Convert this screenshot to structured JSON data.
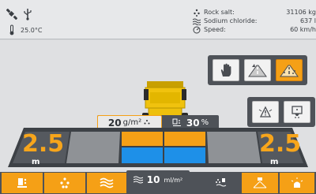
{
  "status": {
    "gps_icon": "satellite-gps-icon",
    "usb_icon": "usb-icon",
    "thermometer_icon": "thermometer-icon",
    "temperature": "25.0°C"
  },
  "stats": [
    {
      "icon": "salt-dots-icon",
      "label": "Rock salt:",
      "value": "31106 kg"
    },
    {
      "icon": "liquid-waves-icon",
      "label": "Sodium chloride:",
      "value": "637 l"
    },
    {
      "icon": "speedometer-icon",
      "label": "Speed:",
      "value": "60 km/h"
    }
  ],
  "mode_buttons": [
    {
      "name": "manual-hand-button",
      "icon": "hand-icon",
      "active": false
    },
    {
      "name": "road-spread-button",
      "icon": "road-icon",
      "active": false
    },
    {
      "name": "road-auto-button",
      "icon": "road-salt-icon",
      "active": true
    }
  ],
  "aux_buttons": [
    {
      "name": "warning-light-button",
      "icon": "beacon-icon"
    },
    {
      "name": "salt-hopper-button",
      "icon": "hopper-icon"
    }
  ],
  "spread": {
    "rate_value": "20",
    "rate_unit": "g/m²",
    "pct_value": "30",
    "pct_unit": "%",
    "left_width": "2.5",
    "right_width": "2.5",
    "width_unit": "m",
    "liquid_value": "10",
    "liquid_unit": "ml/m²"
  },
  "colors": {
    "accent": "#f5a016",
    "spread_blue": "#1e90e8",
    "panel_dark": "#4e5258"
  }
}
